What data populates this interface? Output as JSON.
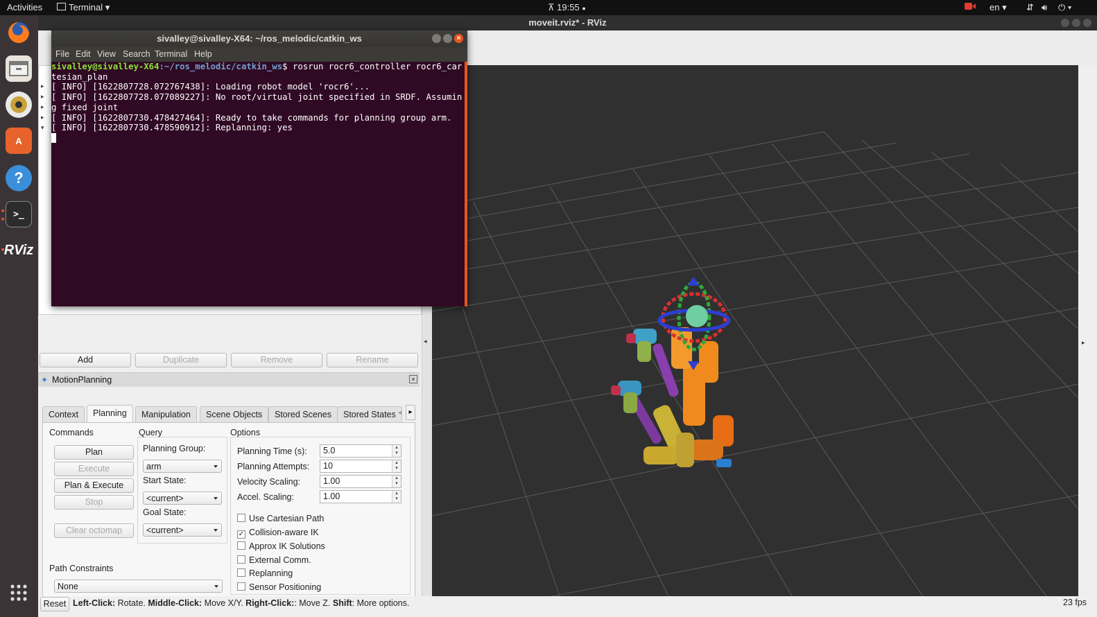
{
  "topbar": {
    "activities": "Activities",
    "app_menu": "Terminal",
    "clock": "19:55",
    "lang": "en"
  },
  "rviz": {
    "title": "moveit.rviz* - RViz",
    "fps": "23 fps",
    "displays_buttons": [
      "Add",
      "Duplicate",
      "Remove",
      "Rename"
    ],
    "status": {
      "reset": "Reset",
      "b1": "Left-Click:",
      "t1": " Rotate. ",
      "b2": "Middle-Click:",
      "t2": " Move X/Y. ",
      "b3": "Right-Click:",
      "t3": ": Move Z. ",
      "b4": "Shift",
      "t4": ": More options."
    }
  },
  "motion": {
    "panel_title": "MotionPlanning",
    "tabs": [
      "Context",
      "Planning",
      "Manipulation",
      "Scene Objects",
      "Stored Scenes",
      "Stored States"
    ],
    "commands_title": "Commands",
    "query_title": "Query",
    "options_title": "Options",
    "buttons": {
      "plan": "Plan",
      "execute": "Execute",
      "plan_execute": "Plan & Execute",
      "stop": "Stop",
      "clear_octomap": "Clear octomap"
    },
    "planning_group_label": "Planning Group:",
    "planning_group": "arm",
    "start_state_label": "Start State:",
    "start_state": "<current>",
    "goal_state_label": "Goal State:",
    "goal_state": "<current>",
    "opt_labels": [
      "Planning Time (s):",
      "Planning Attempts:",
      "Velocity Scaling:",
      "Accel. Scaling:"
    ],
    "opt_values": [
      "5.0",
      "10",
      "1.00",
      "1.00"
    ],
    "checkboxes": [
      "Use Cartesian Path",
      "Collision-aware IK",
      "Approx IK Solutions",
      "External Comm.",
      "Replanning",
      "Sensor Positioning"
    ],
    "checked": [
      false,
      true,
      false,
      false,
      false,
      false
    ],
    "path_constraints_label": "Path Constraints",
    "path_constraints": "None"
  },
  "terminal": {
    "title": "sivalley@sivalley-X64: ~/ros_melodic/catkin_ws",
    "menu": [
      "File",
      "Edit",
      "View",
      "Search",
      "Terminal",
      "Help"
    ],
    "prompt_user": "sivalley@sivalley-X64",
    "prompt_path": ":~/ros_melodic/catkin_ws",
    "command": "$ rosrun rocr6_controller rocr6_car",
    "lines": [
      "tesian_plan",
      "[ INFO] [1622807728.072767438]: Loading robot model 'rocr6'...",
      "[ INFO] [1622807728.077089227]: No root/virtual joint specified in SRDF. Assumin",
      "g fixed joint",
      "[ INFO] [1622807730.478427464]: Ready to take commands for planning group arm.",
      "[ INFO] [1622807730.478590912]: Replanning: yes"
    ]
  }
}
